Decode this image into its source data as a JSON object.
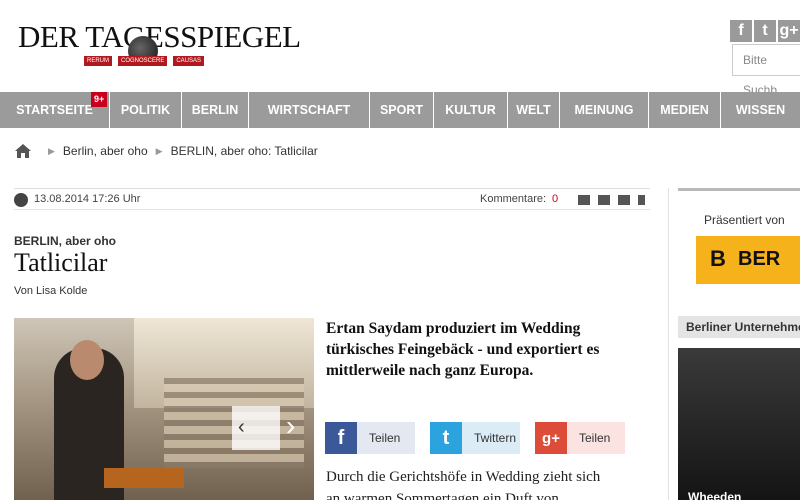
{
  "header": {
    "logo_text": "DER TAGESSPIEGEL",
    "logo_ribbon": [
      "RERUM",
      "COGNOSCERE",
      "CAUSAS"
    ],
    "social": [
      "f",
      "t",
      "g+"
    ],
    "search_placeholder": "Bitte Suchb"
  },
  "nav": {
    "items": [
      "STARTSEITE",
      "POLITIK",
      "BERLIN",
      "WIRTSCHAFT",
      "SPORT",
      "KULTUR",
      "WELT",
      "MEINUNG",
      "MEDIEN",
      "WISSEN"
    ],
    "badge": "9+",
    "bg_color": "#9b9b9b",
    "badge_color": "#c8001e"
  },
  "breadcrumb": {
    "items": [
      "Berlin, aber oho",
      "BERLIN, aber oho: Tatlicilar"
    ]
  },
  "meta": {
    "date": "13.08.2014 17:26 Uhr",
    "comments_label": "Kommentare:",
    "comments_count": "0"
  },
  "article": {
    "kicker": "BERLIN, aber oho",
    "title": "Tatlicilar",
    "author": "Von Lisa Kolde",
    "lead": "Ertan Saydam produziert im Wedding türkisches Feingebäck - und exportiert es mittlerweile nach ganz Europa.",
    "body_start": "Durch die Gerichtshöfe in Wedding zieht sich an warmen Sommertagen ein Duft von"
  },
  "share": {
    "facebook_label": "Teilen",
    "twitter_label": "Twittern",
    "gplus_label": "Teilen",
    "facebook_icon": "f",
    "twitter_icon": "t",
    "gplus_icon": "g+"
  },
  "sidebar": {
    "presented": "Präsentiert von",
    "sponsor_text": "BER",
    "sponsor_logo": "B",
    "business_header": "Berliner Unternehmen",
    "photo_caption": "Wheeden"
  }
}
